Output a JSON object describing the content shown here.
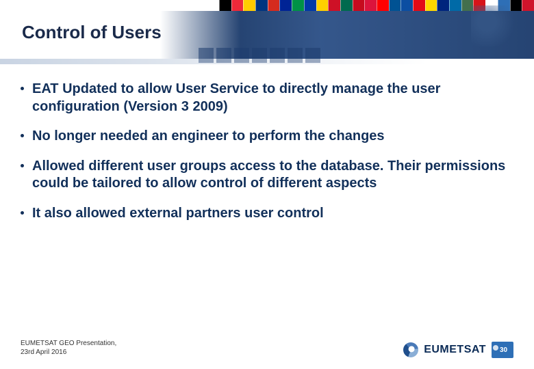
{
  "title": "Control of Users",
  "bullets": [
    "EAT Updated to allow User Service to directly manage the user configuration (Version 3 2009)",
    "No longer needed an engineer to perform the changes",
    "Allowed different user groups access to the database. Their permissions could be tailored to allow control of different aspects",
    "It also allowed external partners user control"
  ],
  "footer": {
    "line1": "EUMETSAT GEO Presentation,",
    "line2": "23rd April 2016"
  },
  "logo": {
    "text": "EUMETSAT",
    "badge": "30"
  },
  "flagColors": [
    "#000",
    "#ed2939",
    "#ffcc00",
    "#003580",
    "#d52b1e",
    "#002395",
    "#009246",
    "#0038a8",
    "#ffce00",
    "#ce1126",
    "#006a4e",
    "#c60b1e",
    "#dc143c",
    "#ff0000",
    "#005293",
    "#0b4ea2",
    "#e30a17",
    "#ffd700",
    "#00247d",
    "#006aa7",
    "#436f4d",
    "#d7141a",
    "#ffffff",
    "#2e6fb6",
    "#000",
    "#cf142b"
  ]
}
